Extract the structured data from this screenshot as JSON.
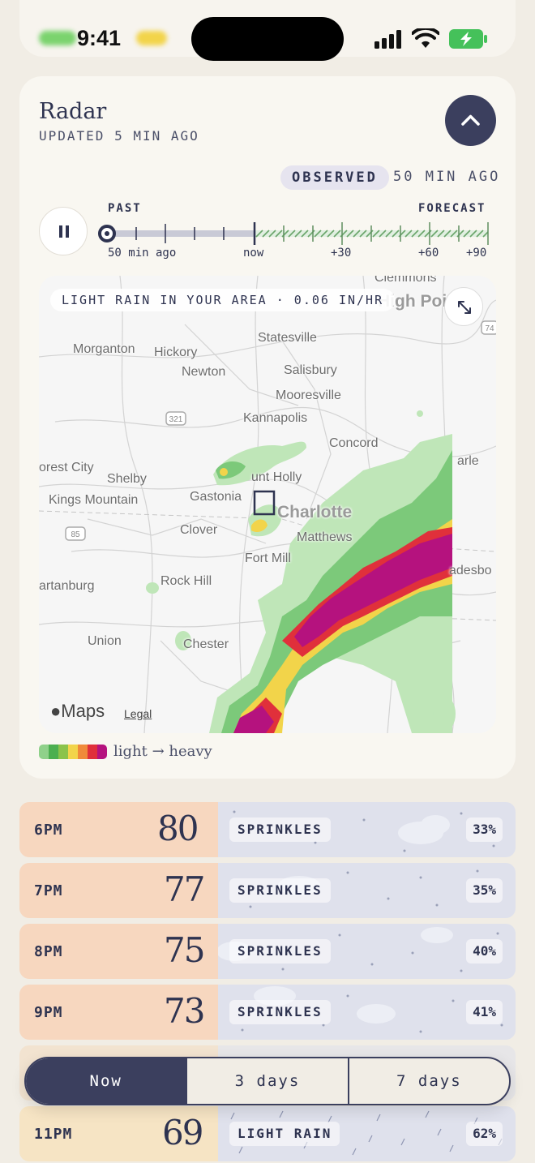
{
  "status_bar": {
    "time": "9:41",
    "icons": [
      "signal-icon",
      "wifi-icon",
      "battery-charging-icon"
    ]
  },
  "radar": {
    "title": "Radar",
    "updated": "UPDATED 5 MIN AGO",
    "observed_label": "OBSERVED",
    "observed_ago": "50 MIN AGO",
    "past_label": "PAST",
    "forecast_label": "FORECAST",
    "ticks": [
      "50 min ago",
      "now",
      "+30",
      "+60",
      "+90"
    ],
    "map_caption": "LIGHT RAIN IN YOUR AREA · 0.06 IN/HR",
    "cities": [
      "Clemmons",
      "High Poin",
      "Statesville",
      "Morganton",
      "Hickory",
      "Newton",
      "Salisbury",
      "Mooresville",
      "Kannapolis",
      "Concord",
      "orest City",
      "Shelby",
      "unt Holly",
      "Kings Mountain",
      "Gastonia",
      "Charlotte",
      "Clover",
      "Matthews",
      "Fort Mill",
      "artanburg",
      "Rock Hill",
      "adesbo",
      "Union",
      "Chester",
      "arle"
    ],
    "highway_shields": [
      "321",
      "85",
      "74"
    ],
    "maps_brand": "Maps",
    "maps_legal": "Legal",
    "legend_text": "light → heavy",
    "legend_colors": [
      "#8fd18a",
      "#4caf50",
      "#8bc34a",
      "#f2d44a",
      "#f08a3a",
      "#e0303b",
      "#b5127e"
    ]
  },
  "hourly": [
    {
      "time": "6PM",
      "temp": "80",
      "condition": "SPRINKLES",
      "precip": "33%"
    },
    {
      "time": "7PM",
      "temp": "77",
      "condition": "SPRINKLES",
      "precip": "35%"
    },
    {
      "time": "8PM",
      "temp": "75",
      "condition": "SPRINKLES",
      "precip": "40%"
    },
    {
      "time": "9PM",
      "temp": "73",
      "condition": "SPRINKLES",
      "precip": "41%"
    },
    {
      "time": "11PM",
      "temp": "69",
      "condition": "LIGHT RAIN",
      "precip": "62%"
    }
  ],
  "segments": {
    "now": "Now",
    "three_days": "3 days",
    "seven_days": "7 days"
  }
}
